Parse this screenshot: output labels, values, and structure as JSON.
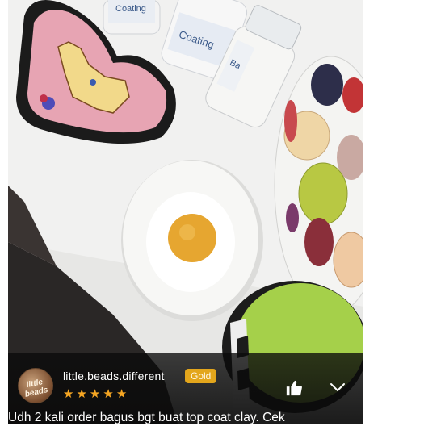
{
  "review": {
    "username": "little.beads.different",
    "badge": "Gold",
    "avatar_text": "little beads",
    "rating": 5,
    "stars": [
      "★",
      "★",
      "★",
      "★",
      "★"
    ],
    "text": "Udh 2 kali order bagus bgt buat top coat clay. Cek"
  },
  "photo": {
    "bottle_labels": [
      "Coating",
      "Coating",
      "Ba"
    ]
  },
  "icons": {
    "like": "thumbs-up-icon",
    "more": "chevron-down-icon",
    "star": "star-icon"
  },
  "colors": {
    "badge": "#e3a61c",
    "star": "#f5a623",
    "overlay": "#0a0a0a"
  }
}
